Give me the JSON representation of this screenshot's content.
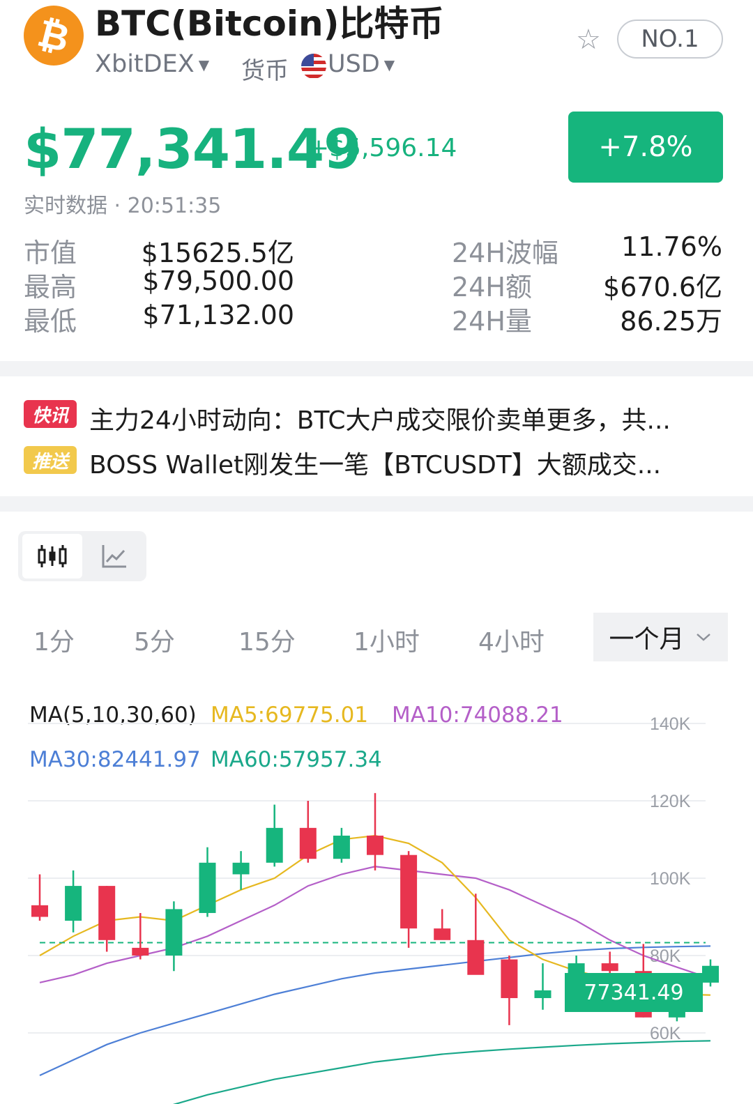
{
  "header": {
    "title": "BTC(Bitcoin)比特币",
    "logo_symbol": "₿",
    "exchange": "XbitDEX",
    "currency_label": "货币",
    "currency": "USD",
    "rank": "NO.1",
    "icons": [
      "bitcoin-logo",
      "star-icon",
      "us-flag-icon",
      "caret-down-icon"
    ]
  },
  "price": {
    "value": "$77,341.49",
    "change": "+$5,596.14",
    "change_pct": "+7.8%",
    "realtime": "实时数据 · 20:51:35"
  },
  "stats": {
    "left": [
      {
        "label": "市值",
        "value": "$15625.5亿"
      },
      {
        "label": "最高",
        "value": "$79,500.00"
      },
      {
        "label": "最低",
        "value": "$71,132.00"
      }
    ],
    "right": [
      {
        "label": "24H波幅",
        "value": "11.76%"
      },
      {
        "label": "24H额",
        "value": "$670.6亿"
      },
      {
        "label": "24H量",
        "value": "86.25万"
      }
    ]
  },
  "news": [
    {
      "tag": "快讯",
      "text": "主力24小时动向：BTC大户成交限价卖单更多，共..."
    },
    {
      "tag": "推送",
      "text": "BOSS Wallet刚发生一笔【BTCUSDT】大额成交..."
    }
  ],
  "chart_toggle": {
    "active": "candlestick-icon",
    "inactive": "line-chart-icon"
  },
  "periods": [
    "1分",
    "5分",
    "15分",
    "1小时",
    "4小时"
  ],
  "period_selected": "一个月",
  "colors": {
    "up": "#16b57d",
    "down": "#e8344e",
    "ma5": "#e6b820",
    "ma10": "#b45fc8",
    "ma30": "#4d7fd6",
    "ma60": "#1aa88a"
  },
  "chart_data": {
    "type": "candlestick",
    "ma_title": "MA(5,10,30,60)",
    "ma_labels": {
      "ma5": "MA5:69775.01",
      "ma10": "MA10:74088.21",
      "ma30": "MA30:82441.97",
      "ma60": "MA60:57957.34"
    },
    "y_ticks": [
      "140K",
      "120K",
      "100K",
      "80K",
      "60K"
    ],
    "y_tick_values": [
      140000,
      120000,
      100000,
      80000,
      60000
    ],
    "ylim": [
      49000,
      145000
    ],
    "current_price": 77341.49,
    "current_price_label": "77341.49",
    "candles": [
      {
        "o": 93000,
        "h": 101000,
        "l": 89000,
        "c": 90000
      },
      {
        "o": 89000,
        "h": 102000,
        "l": 86000,
        "c": 98000
      },
      {
        "o": 98000,
        "h": 98000,
        "l": 81000,
        "c": 84000
      },
      {
        "o": 82000,
        "h": 91000,
        "l": 79000,
        "c": 80000
      },
      {
        "o": 80000,
        "h": 94000,
        "l": 76000,
        "c": 92000
      },
      {
        "o": 91000,
        "h": 108000,
        "l": 90000,
        "c": 104000
      },
      {
        "o": 101000,
        "h": 107000,
        "l": 97000,
        "c": 104000
      },
      {
        "o": 104000,
        "h": 119000,
        "l": 103000,
        "c": 113000
      },
      {
        "o": 113000,
        "h": 120000,
        "l": 104000,
        "c": 105000
      },
      {
        "o": 105000,
        "h": 113000,
        "l": 104000,
        "c": 111000
      },
      {
        "o": 111000,
        "h": 122000,
        "l": 102000,
        "c": 106000
      },
      {
        "o": 106000,
        "h": 107000,
        "l": 82000,
        "c": 87000
      },
      {
        "o": 87000,
        "h": 92000,
        "l": 85000,
        "c": 84000
      },
      {
        "o": 84000,
        "h": 96000,
        "l": 78000,
        "c": 75000
      },
      {
        "o": 79000,
        "h": 80000,
        "l": 62000,
        "c": 69000
      },
      {
        "o": 69000,
        "h": 78000,
        "l": 66000,
        "c": 71000
      },
      {
        "o": 71000,
        "h": 80000,
        "l": 70000,
        "c": 78000
      },
      {
        "o": 78000,
        "h": 81000,
        "l": 74000,
        "c": 76000
      },
      {
        "o": 76000,
        "h": 83000,
        "l": 64000,
        "c": 64000
      },
      {
        "o": 64000,
        "h": 68000,
        "l": 63000,
        "c": 67000
      },
      {
        "o": 73000,
        "h": 79000,
        "l": 72000,
        "c": 77341
      }
    ],
    "ma5": [
      80000,
      85000,
      89000,
      90000,
      89000,
      93000,
      97000,
      100000,
      106000,
      110000,
      111000,
      109000,
      104000,
      95000,
      84000,
      79000,
      76000,
      74000,
      72000,
      70000,
      69775
    ],
    "ma10": [
      73000,
      75000,
      78000,
      80000,
      82000,
      85000,
      89000,
      93000,
      98000,
      101000,
      103000,
      102000,
      101000,
      100000,
      97000,
      93000,
      89000,
      84000,
      80000,
      77000,
      74088
    ],
    "ma30": [
      49000,
      53000,
      57000,
      60000,
      62500,
      65000,
      67500,
      70000,
      72000,
      74000,
      75500,
      76500,
      77500,
      78500,
      79500,
      80500,
      81300,
      81800,
      82100,
      82300,
      82442
    ],
    "ma60": [
      30000,
      33000,
      36000,
      39000,
      41500,
      44000,
      46000,
      48000,
      49500,
      51000,
      52500,
      53500,
      54500,
      55200,
      55800,
      56300,
      56800,
      57200,
      57500,
      57800,
      57957
    ]
  }
}
